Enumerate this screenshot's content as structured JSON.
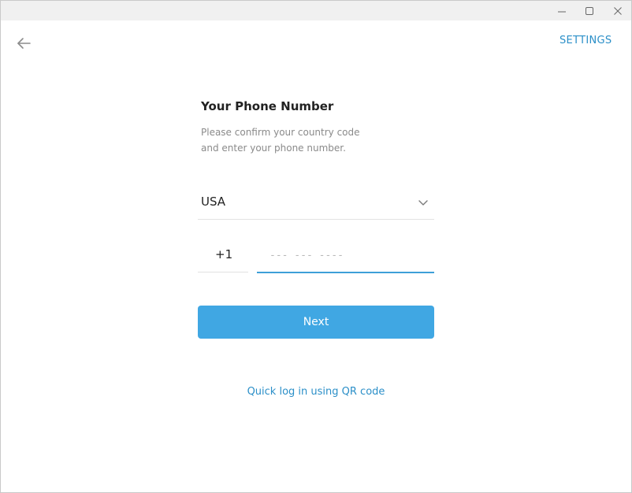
{
  "window": {
    "controls": {
      "minimize_icon": "minimize-icon",
      "maximize_icon": "maximize-icon",
      "close_icon": "close-icon"
    }
  },
  "header": {
    "back_icon": "arrow-left-icon",
    "settings_label": "SETTINGS"
  },
  "login": {
    "title": "Your Phone Number",
    "description_line1": "Please confirm your country code",
    "description_line2": "and enter your phone number.",
    "country": {
      "value": "USA",
      "icon": "chevron-down-icon"
    },
    "country_code": "+1",
    "phone": {
      "value": "",
      "placeholder": "--- --- ----"
    },
    "next_label": "Next",
    "qr_link_label": "Quick log in using QR code"
  },
  "colors": {
    "accent": "#40a7e3",
    "link": "#2b8fc8",
    "title_text": "#222222",
    "muted_text": "#8a8a8a"
  }
}
